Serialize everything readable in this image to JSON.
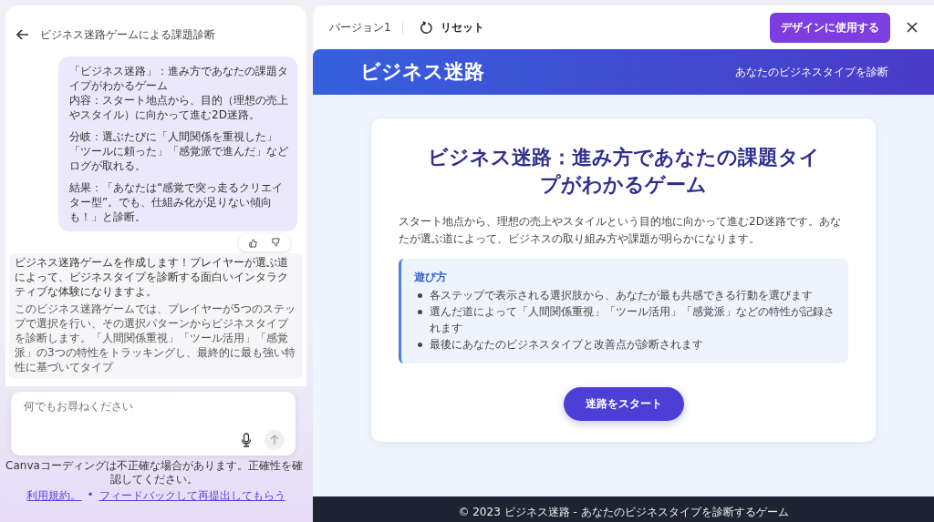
{
  "chat": {
    "title": "ビジネス迷路ゲームによる課題診断",
    "user_message": [
      [
        "「ビジネス迷路」：進み方であなたの課題タイプがわかるゲーム",
        "内容：スタート地点から、目的（理想の売上やスタイル）に向かって進む2D迷路。"
      ],
      [
        "分岐：選ぶたびに「人間関係を重視した」「ツールに頼った」「感覚派で進んだ」などログが取れる。"
      ],
      [
        "結果：「あなたは“感覚で突っ走るクリエイター型”。でも、仕組み化が足りない傾向も！」と診断。"
      ]
    ],
    "assistant_paragraphs": [
      "ビジネス迷路ゲームを作成します！プレイヤーが選ぶ道によって、ビジネスタイプを診断する面白いインタラクティブな体験になりますよ。",
      "このビジネス迷路ゲームでは、プレイヤーが5つのステップで選択を行い、その選択パターンからビジネスタイプを診断します。「人間関係重視」「ツール活用」「感覚派」の3つの特性をトラッキングし、最終的に最も強い特性に基づいてタイプ"
    ],
    "input": {
      "placeholder": "何でもお尋ねください"
    },
    "disclaimer": "Canvaコーディングは不正確な場合があります。正確性を確認してください。",
    "links": [
      "利用規約。",
      "•",
      "フィードバックして再提出してもらう"
    ]
  },
  "preview": {
    "version": "バージョン1",
    "reset": "リセット",
    "use_button": "デザインに使用する",
    "banner": {
      "title": "ビジネス迷路",
      "subtitle": "あなたのビジネスタイプを診断"
    },
    "card": {
      "title": "ビジネス迷路：進み方であなたの課題タイプがわかるゲーム",
      "description": "スタート地点から、理想の売上やスタイルという目的地に向かって進む2D迷路です。あなたが選ぶ道によって、ビジネスの取り組み方や課題が明らかになります。",
      "howto_title": "遊び方",
      "howto_items": [
        "各ステップで表示される選択肢から、あなたが最も共感できる行動を選びます",
        "選んだ道によって「人間関係重視」「ツール活用」「感覚派」などの特性が記録されます",
        "最後にあなたのビジネスタイプと改善点が診断されます"
      ],
      "start_button": "迷路をスタート"
    },
    "footer": "© 2023 ビジネス迷路 - あなたのビジネスタイプを診断するゲーム"
  }
}
